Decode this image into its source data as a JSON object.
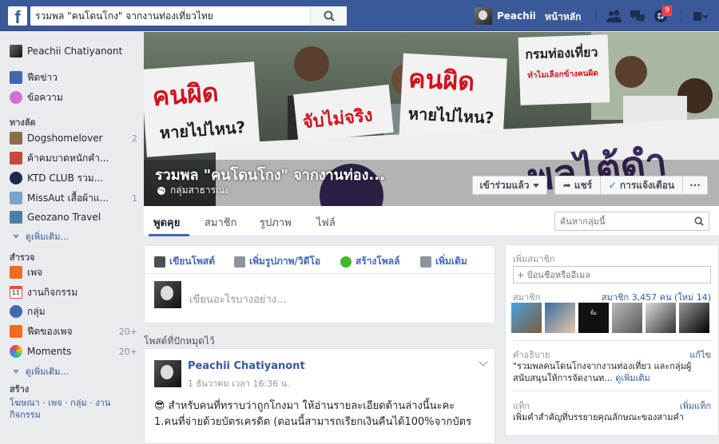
{
  "topbar": {
    "logo": "f",
    "search_value": "รวมพล \"คนโดนโกง\" จากงานท่องเที่ยวไทย",
    "user_name": "Peachii",
    "home_label": "หน้าหลัก",
    "notif_count": "9",
    "icons": [
      "friends-icon",
      "messages-icon",
      "notifications-icon",
      "settings-icon"
    ]
  },
  "leftnav": {
    "profile_name": "Peachii Chatiyanont",
    "main": [
      {
        "label": "ฟีดข่าว",
        "icon": "news-feed-icon",
        "color": "#4267b2"
      },
      {
        "label": "ข้อความ",
        "icon": "messages-icon",
        "color": "#d76ed4"
      }
    ],
    "shortcuts_title": "ทางลัด",
    "shortcuts": [
      {
        "label": "Dogshomelover",
        "count": "2",
        "icon": "group-dog-icon",
        "color": "#8b6d4d"
      },
      {
        "label": "ค้าคมบาดหนักคำ...",
        "count": "",
        "icon": "group-quote-icon",
        "color": "#c8473e"
      },
      {
        "label": "KTD CLUB รวม...",
        "count": "",
        "icon": "group-ktd-icon",
        "color": "#1b2a4a"
      },
      {
        "label": "MissAut เสื้อผ้าแ...",
        "count": "1",
        "icon": "group-fashion-icon",
        "color": "#7aa4c9"
      },
      {
        "label": "Geozano Travel",
        "count": "",
        "icon": "group-travel-icon",
        "color": "#4d7fa6"
      }
    ],
    "see_more": "ดูเพิ่มเติม...",
    "explore_title": "สำรวจ",
    "explore": [
      {
        "label": "เพจ",
        "count": "",
        "icon": "pages-icon",
        "color": "#f36b21"
      },
      {
        "label": "งานกิจกรรม",
        "count": "",
        "icon": "events-icon",
        "color": "#e74c3c"
      },
      {
        "label": "กลุ่ม",
        "count": "",
        "icon": "groups-icon",
        "color": "#4267b2"
      },
      {
        "label": "ฟีดของเพจ",
        "count": "20+",
        "icon": "pages-feed-icon",
        "color": "#f36b21"
      },
      {
        "label": "Moments",
        "count": "20+",
        "icon": "moments-icon",
        "color": "#8e44ad"
      }
    ],
    "see_more2": "ดูเพิ่มเติม...",
    "create_title": "สร้าง",
    "create_links": "โฆษณา · เพจ · กลุ่ม · งานกิจกรรม"
  },
  "cover": {
    "group_name": "รวมพล \"คนโดนโกง\" จากงานท่อง...",
    "privacy": "กลุ่มสาธารณะ",
    "joined_button": "เข้าร่วมแล้ว",
    "share_button": "แชร์",
    "notify_button": "การแจ้งเตือน",
    "more_button": "···",
    "signs": [
      "คนผิด",
      "หายไปไหน?",
      "จับไม่จริง",
      "คนผิด",
      "หายไปไหน?",
      "กรมท่องเที่ยว",
      "ทำไมเลือกข้างคนผิด"
    ]
  },
  "tabs": {
    "items": [
      "พูดคุย",
      "สมาชิก",
      "รูปภาพ",
      "ไฟล์"
    ],
    "search_placeholder": "ค้นหากลุ่มนี้"
  },
  "composer": {
    "tabs": [
      "เขียนโพสต์",
      "เพิ่มรูปภาพ/วิดีโอ",
      "สร้างโพลล์",
      "เพิ่มเติม"
    ],
    "placeholder": "เขียนอะไรบางอย่าง..."
  },
  "pinned": {
    "heading": "โพสต์ที่ปักหมุดไว้",
    "author": "Peachii Chatiyanont",
    "time": "1 ธันวาคม เวลา 16:36 น.",
    "line1": "😎 สำหรับคนที่ทราบว่าถูกโกงมา ให้อ่านรายละเอียดด้านล่างนี้นะคะ",
    "line2": "1.คนที่จ่ายด้วยบัตรเครดิต (ตอนนี้สามารถเรียกเงินคืนได้100%จากบัตร"
  },
  "right": {
    "add_members_title": "เพิ่มสมาชิก",
    "add_members_placeholder": "+ ป้อนชื่อหรืออีเมล",
    "members_title": "สมาชิก",
    "members_count": "สมาชิก 3,457 คน (ใหม่ 14)",
    "description_title": "คำอธิบาย",
    "edit_label": "แก้ไข",
    "description_text": "\"รวมพลคนโดนโกงจากงานท่องเที่ยว และกลุ่มผู้สนับสนุนให้การจัดงานท...",
    "see_more": "ดูเพิ่มเติม",
    "tags_title": "แท็ก",
    "add_tags": "เพิ่มแท็ก",
    "tags_text": "เพิ่มคำสำคัญที่บรรยายคุณลักษณะของสามคำ"
  }
}
